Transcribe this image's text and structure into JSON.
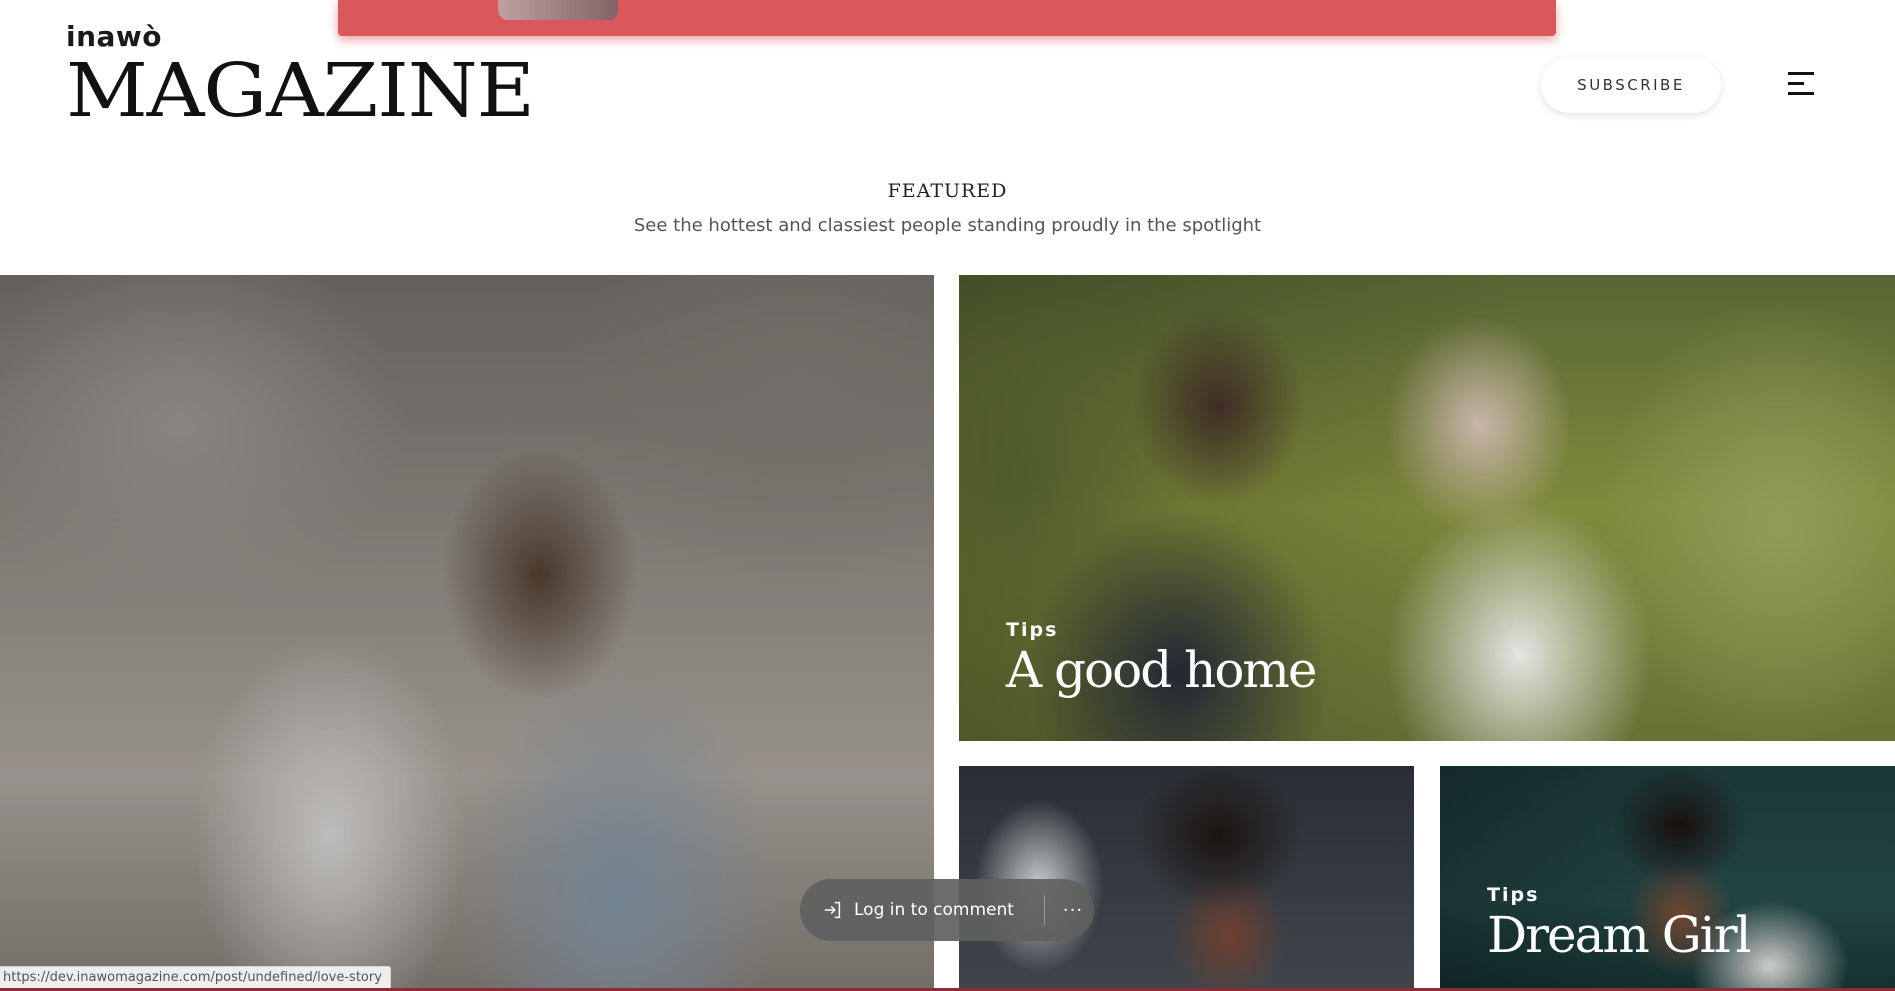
{
  "header": {
    "logo_small": "inawò",
    "logo_big": "MAGAZINE",
    "subscribe_label": "SUBSCRIBE"
  },
  "featured": {
    "heading": "FEATURED",
    "subheading": "See the hottest and classiest people standing proudly in the spotlight"
  },
  "cards": [
    {
      "category": "",
      "title": ""
    },
    {
      "category": "Tips",
      "title": "A good home"
    },
    {
      "category": "",
      "title": ""
    },
    {
      "category": "Tips",
      "title": "Dream Girl"
    }
  ],
  "comment_bar": {
    "login_label": "Log in to comment",
    "more_label": "···"
  },
  "status_bar": {
    "url": "https://dev.inawomagazine.com/post/undefined/love-story"
  },
  "colors": {
    "banner": "#d9585b",
    "accent_bottom": "#8e2a3a"
  }
}
